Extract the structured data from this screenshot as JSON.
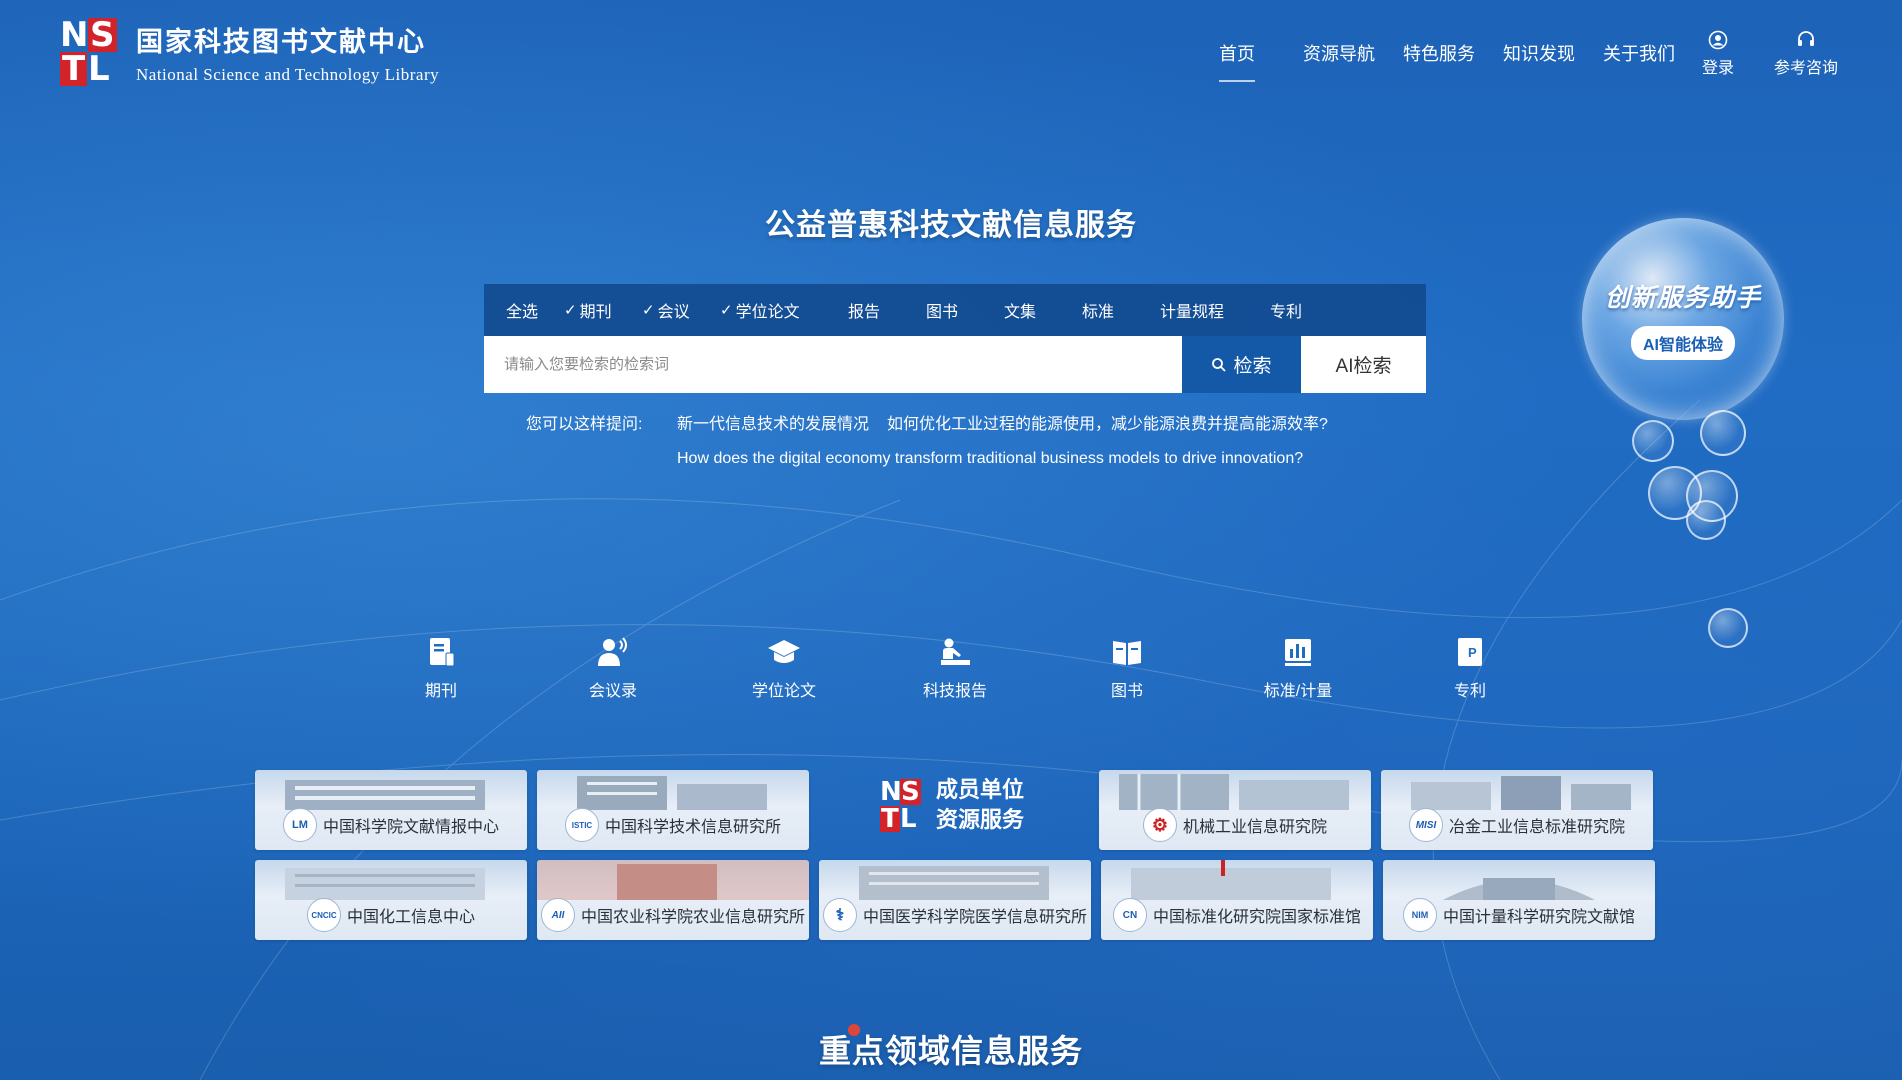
{
  "header": {
    "logo_cn": "国家科技图书文献中心",
    "logo_en": "National Science and Technology Library",
    "logo_letters": [
      "N",
      "S",
      "T",
      "L"
    ],
    "nav": [
      "首页",
      "资源导航",
      "特色服务",
      "知识发现",
      "关于我们"
    ],
    "login_label": "登录",
    "consult_label": "参考咨询"
  },
  "hero": {
    "slogan": "公益普惠科技文献信息服务",
    "tabs": [
      {
        "label": "全选",
        "checked": false
      },
      {
        "label": "期刊",
        "checked": true
      },
      {
        "label": "会议",
        "checked": true
      },
      {
        "label": "学位论文",
        "checked": true
      },
      {
        "label": "报告",
        "checked": false
      },
      {
        "label": "图书",
        "checked": false
      },
      {
        "label": "文集",
        "checked": false
      },
      {
        "label": "标准",
        "checked": false
      },
      {
        "label": "计量规程",
        "checked": false
      },
      {
        "label": "专利",
        "checked": false
      }
    ],
    "search_placeholder": "请输入您要检索的检索词",
    "search_button": "检索",
    "ai_search_button": "AI检索",
    "suggest_label": "您可以这样提问:",
    "suggestions": [
      "新一代信息技术的发展情况",
      "如何优化工业过程的能源使用，减少能源浪费并提高能源效率?",
      "How does the digital economy transform traditional business models to drive innovation?"
    ]
  },
  "assistant": {
    "title": "创新服务助手",
    "button": "AI智能体验"
  },
  "categories": [
    "期刊",
    "会议录",
    "学位论文",
    "科技报告",
    "图书",
    "标准/计量",
    "专利"
  ],
  "members": {
    "center_line1": "成员单位",
    "center_line2": "资源服务",
    "units": [
      {
        "name": "中国科学院文献情报中心",
        "logo": "LM"
      },
      {
        "name": "中国科学技术信息研究所",
        "logo": "ISTIC"
      },
      {
        "name": "机械工业信息研究院",
        "logo": "⚙"
      },
      {
        "name": "冶金工业信息标准研究院",
        "logo": "MISI"
      },
      {
        "name": "中国化工信息中心",
        "logo": "CNCIC"
      },
      {
        "name": "中国农业科学院农业信息研究所",
        "logo": "AII"
      },
      {
        "name": "中国医学科学院医学信息研究所",
        "logo": "⚕"
      },
      {
        "name": "中国标准化研究院国家标准馆",
        "logo": "CN"
      },
      {
        "name": "中国计量科学研究院文献馆",
        "logo": "NIM"
      }
    ]
  },
  "key_section_title": "重点领域信息服务",
  "colors": {
    "background": "#1f6cc3",
    "search_bar": "#10488c",
    "search_button": "#1458a8",
    "logo_red": "#d2232a",
    "accent_dot": "#e0453a"
  }
}
